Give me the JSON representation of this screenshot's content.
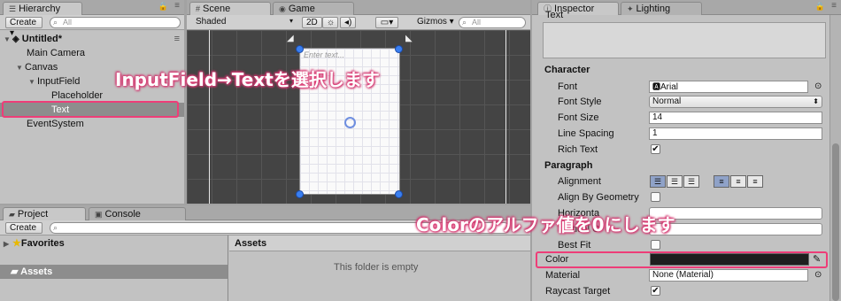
{
  "hierarchy": {
    "tab": "Hierarchy",
    "create": "Create ▾",
    "search_placeholder": "All",
    "scene": "Untitled*",
    "items": [
      "Main Camera",
      "Canvas",
      "InputField",
      "Placeholder",
      "Text",
      "EventSystem"
    ]
  },
  "scene": {
    "tab_scene": "Scene",
    "tab_game": "Game",
    "shading": "Shaded",
    "mode_2d": "2D",
    "gizmos": "Gizmos ▾",
    "search_placeholder": "All",
    "placeholder_text": "Enter text..."
  },
  "project": {
    "tab_project": "Project",
    "tab_console": "Console",
    "create": "Create ▾",
    "favorites": "Favorites",
    "assets": "Assets",
    "assets_header": "Assets",
    "empty": "This folder is empty"
  },
  "inspector": {
    "tab_inspector": "Inspector",
    "tab_lighting": "Lighting",
    "text_label": "Text",
    "character": "Character",
    "font_label": "Font",
    "font_value": "Arial",
    "font_style_label": "Font Style",
    "font_style_value": "Normal",
    "font_size_label": "Font Size",
    "font_size_value": "14",
    "line_spacing_label": "Line Spacing",
    "line_spacing_value": "1",
    "rich_text_label": "Rich Text",
    "paragraph": "Paragraph",
    "alignment_label": "Alignment",
    "align_geometry_label": "Align By Geometry",
    "horizontal_label": "Horizonta",
    "vertical_label": "Vertical O",
    "best_fit_label": "Best Fit",
    "color_label": "Color",
    "material_label": "Material",
    "material_value": "None (Material)",
    "raycast_label": "Raycast Target"
  },
  "callouts": {
    "top": "InputField→Textを選択します",
    "bottom": "Colorのアルファ値を0にします"
  },
  "colors": {
    "accent": "#ee3d78",
    "color_swatch": "#1e1e1e"
  }
}
